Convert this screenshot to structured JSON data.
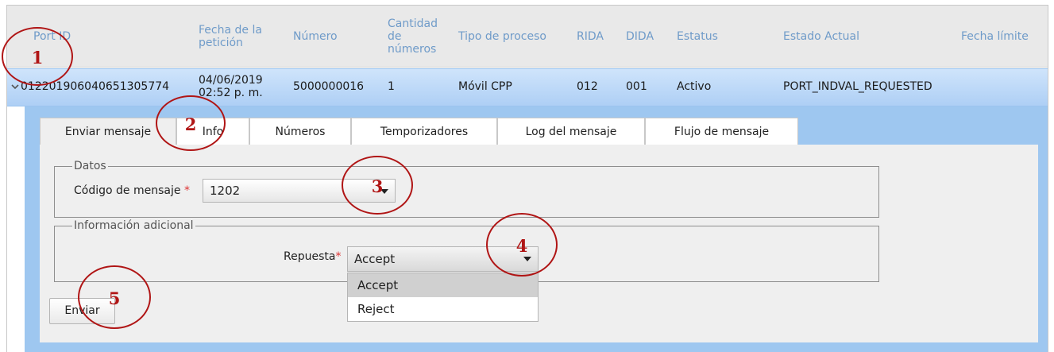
{
  "table": {
    "headers": {
      "port_id": "Port ID",
      "fecha_1": "Fecha de la",
      "fecha_2": "petición",
      "numero": "Número",
      "cantidad_1": "Cantidad",
      "cantidad_2": "de",
      "cantidad_3": "números",
      "tipo": "Tipo de proceso",
      "rida": "RIDA",
      "dida": "DIDA",
      "estatus": "Estatus",
      "estado_actual": "Estado Actual",
      "fecha_limite": "Fecha límite"
    },
    "row": {
      "port_id": "012201906040651305774",
      "fecha_1": "04/06/2019",
      "fecha_2": "02:52 p. m.",
      "numero": "5000000016",
      "cantidad": "1",
      "tipo": "Móvil CPP",
      "rida": "012",
      "dida": "001",
      "estatus": "Activo",
      "estado_actual": "PORT_INDVAL_REQUESTED",
      "fecha_limite": ""
    }
  },
  "tabs": [
    "Enviar mensaje",
    "Info",
    "Números",
    "Temporizadores",
    "Log del mensaje",
    "Flujo de mensaje"
  ],
  "form": {
    "datos_legend": "Datos",
    "codigo_label": "Código de mensaje",
    "required_mark": "*",
    "codigo_value": "1202",
    "info_legend": "Información adicional",
    "respuesta_label": "Repuesta",
    "respuesta_value": "Accept",
    "options": [
      "Accept",
      "Reject"
    ],
    "submit_label": "Enviar"
  },
  "markers": [
    "1",
    "2",
    "3",
    "4",
    "5"
  ],
  "colors": {
    "header_text": "#6f9bc9",
    "selected_row": "#aecff5",
    "detail_background": "#9ec7f0",
    "marker": "#b01515"
  },
  "icons": {
    "expand": "chevron-down-icon",
    "select_caret": "caret-down-icon"
  }
}
